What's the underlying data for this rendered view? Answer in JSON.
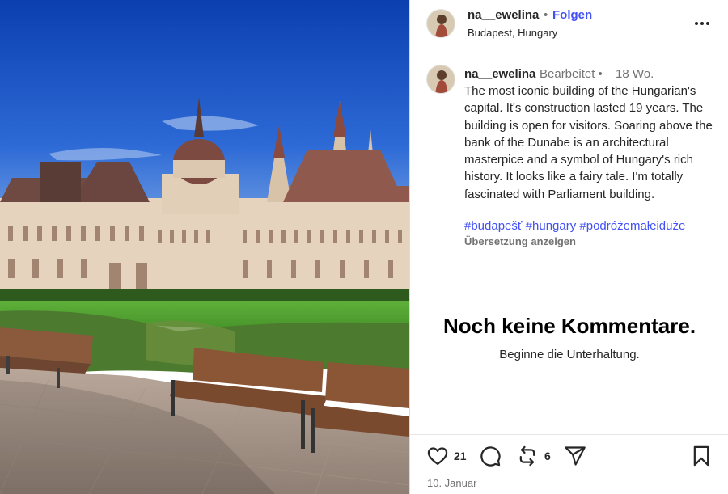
{
  "post": {
    "username": "na__ewelina",
    "separator": "•",
    "follow_label": "Folgen",
    "location": "Budapest, Hungary"
  },
  "caption": {
    "username": "na__ewelina",
    "edited_label": "Bearbeitet •",
    "time_ago": "18 Wo.",
    "text": "The most iconic building of the Hungarian's capital. It's construction lasted 19 years. The building is open for visitors. Soaring above the bank of the Dunabe is an architectural masterpice and a symbol of Hungary's rich history. It looks like a fairy tale. I'm totally fascinated with Parliament building.",
    "hashtags": "#budapešť #hungary #podróżemałeiduże",
    "translate_label": "Übersetzung anzeigen"
  },
  "comments": {
    "empty_title": "Noch keine Kommentare.",
    "empty_subtitle": "Beginne die Unterhaltung."
  },
  "actions": {
    "likes_count": "21",
    "reposts_count": "6",
    "date": "10. Januar"
  },
  "icons": {
    "more": "more-horizontal-icon",
    "like": "heart-icon",
    "comment": "comment-bubble-icon",
    "repost": "repost-arrows-icon",
    "share": "send-paper-plane-icon",
    "save": "bookmark-icon"
  },
  "colors": {
    "link_blue": "#4150f7",
    "text": "#262626",
    "muted": "#737373"
  }
}
